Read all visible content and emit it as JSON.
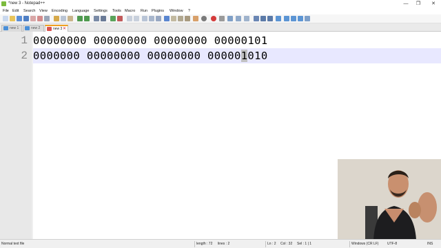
{
  "window": {
    "title": "*new 3 - Notepad++",
    "min": "—",
    "max": "❐",
    "close": "✕"
  },
  "menu": [
    "File",
    "Edit",
    "Search",
    "View",
    "Encoding",
    "Language",
    "Settings",
    "Tools",
    "Macro",
    "Run",
    "Plugins",
    "Window",
    "?"
  ],
  "tabs": [
    {
      "label": "new 1",
      "active": false
    },
    {
      "label": "new 2",
      "active": false
    },
    {
      "label": "new 3",
      "active": true
    }
  ],
  "editor": {
    "lines": [
      {
        "num": "1",
        "text": "00000000 00000000 00000000 00000101"
      },
      {
        "num": "2",
        "before": "0000000 00000000 00000000 00000",
        "selected": "1",
        "after": "010"
      }
    ]
  },
  "status": {
    "file_type": "Normal text file",
    "length": "length : 72",
    "lines": "lines : 2",
    "ln": "Ln : 2",
    "col": "Col : 32",
    "sel": "Sel : 1 | 1",
    "eol": "Windows (CR LF)",
    "encoding": "UTF-8",
    "mode": "INS"
  }
}
